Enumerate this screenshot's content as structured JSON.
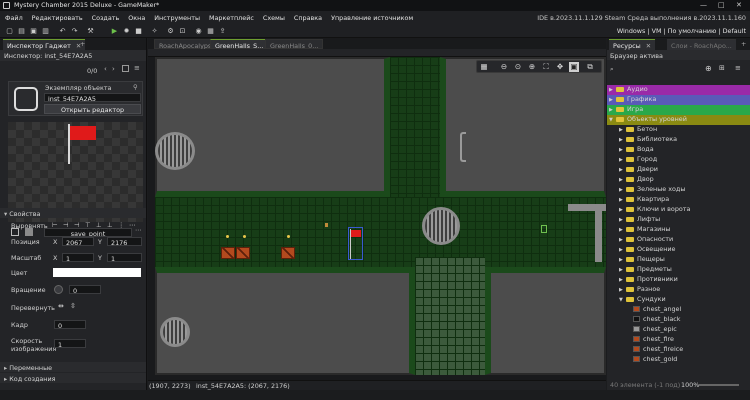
{
  "window": {
    "title": "Mystery Chamber 2015 Deluxe - GameMaker*",
    "controls": [
      "—",
      "□",
      "✕"
    ]
  },
  "menu": [
    "Файл",
    "Редактировать",
    "Создать",
    "Окна",
    "Инструменты",
    "Маркетплейс",
    "Схемы",
    "Справка",
    "Управление источником"
  ],
  "ide_version": "IDE в.2023.11.1.129 Steam Среда выполнения в.2023.11.1.160",
  "toolbar_right": "Windows | VM | По умолчанию | Default",
  "inspector": {
    "tab": "Инспектор Гаджет",
    "subtitle": "Инспектор: inst_54E7A2A5",
    "count": "0/0",
    "instance_title": "Экземпляр объекта",
    "instance_name": "inst_54E7A2A5",
    "open_editor": "Открыть редактор",
    "sprite_name": "save_point",
    "props_header": "Свойства",
    "align_label": "Выровнять",
    "position_label": "Позиция",
    "pos_x": "2067",
    "pos_y": "2176",
    "scale_label": "Масштаб",
    "scale_x": "1",
    "scale_y": "1",
    "color_label": "Цвет",
    "rotation_label": "Вращение",
    "rotation": "0",
    "flip_label": "Перевернуть",
    "frame_label": "Кадр",
    "frame": "0",
    "speed_label": "Скорость изображения",
    "speed": "1",
    "variables": "Переменные",
    "creation_code": "Код создания",
    "x_char": "X",
    "y_char": "Y"
  },
  "editor": {
    "tabs": [
      "RoachApocalypse",
      "GreenHalls_S...",
      "GreenHalls_0..."
    ],
    "status_coords": "(1907, 2273)",
    "status_instance": "inst_54E7A2A5: (2067, 2176)"
  },
  "assets": {
    "tab_active": "Ресурсы",
    "tab_other": "Слои - RoachApo...",
    "browser_title": "Браузер актива",
    "groups": [
      {
        "label": "Аудио",
        "color": "#9a2aa8"
      },
      {
        "label": "Графика",
        "color": "#5a5ab8"
      },
      {
        "label": "Игра",
        "color": "#2aa84a"
      },
      {
        "label": "Объекты уровней",
        "color": "#8a8a12"
      }
    ],
    "folders": [
      "Бетон",
      "Библиотека",
      "Вода",
      "Город",
      "Двери",
      "Двор",
      "Зеленые ходы",
      "Квартира",
      "Ключи и ворота",
      "Лифты",
      "Магазины",
      "Опасности",
      "Освещение",
      "Пещеры",
      "Предметы",
      "Противники",
      "Разное",
      "Сундуки"
    ],
    "items": [
      "chest_angel",
      "chest_black",
      "chest_epic",
      "chest_fire",
      "chest_fireice",
      "chest_gold"
    ],
    "footer": "40 элемента (-1 под)",
    "zoom": "100%"
  }
}
